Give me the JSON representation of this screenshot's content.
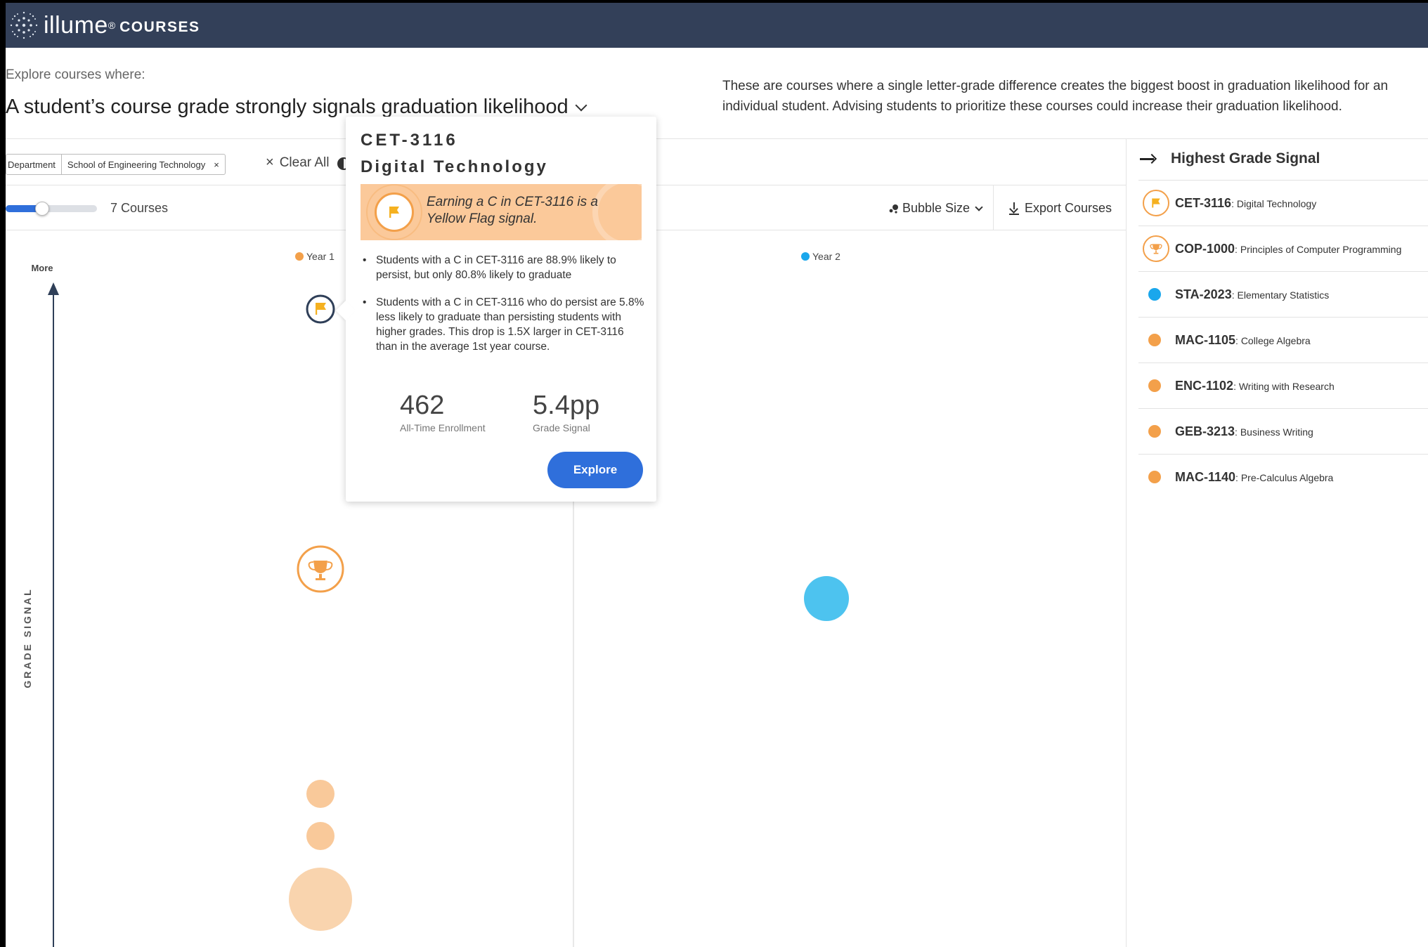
{
  "app": {
    "brand": "illume",
    "brand_mark": "®",
    "product": "COURSES"
  },
  "explore": {
    "label": "Explore courses where:",
    "title": "A student’s course grade strongly signals graduation likelihood",
    "description": "These are courses where a single letter-grade difference creates the biggest boost in graduation likelihood for an individual student. Advising students to prioritize these courses could increase their graduation likelihood."
  },
  "filters": {
    "chip_key": "Department",
    "chip_value": "School of Engineering Technology",
    "chip_remove": "×",
    "clear_all": "Clear All",
    "clear_icon": "×"
  },
  "toolbar": {
    "course_count": "7 Courses",
    "slider_level": 0.4,
    "bubble_size_label": "Bubble Size",
    "export_label": "Export Courses"
  },
  "chart": {
    "axis_top_label": "More",
    "y_axis_label": "GRADE SIGNAL",
    "year1_label": "Year 1",
    "year2_label": "Year 2",
    "colors": {
      "year1": "#f3a04a",
      "year1_light": "#f9c99a",
      "year2": "#4dc3ef",
      "axis": "#2f3f58"
    }
  },
  "chart_data": {
    "type": "scatter",
    "title": "",
    "xlabel": "",
    "ylabel": "GRADE SIGNAL",
    "categories": [
      "Year 1",
      "Year 2"
    ],
    "series": [
      {
        "name": "Year 1",
        "points": [
          {
            "course": "CET-3116",
            "icon": "flag-icon"
          },
          {
            "course": "COP-1000",
            "icon": "trophy-icon"
          },
          {
            "course": "",
            "icon": ""
          },
          {
            "course": "",
            "icon": ""
          },
          {
            "course": "",
            "icon": ""
          }
        ]
      },
      {
        "name": "Year 2",
        "points": [
          {
            "course": "STA-2023",
            "icon": ""
          }
        ]
      }
    ]
  },
  "right_panel": {
    "header": "Highest Grade Signal",
    "items": [
      {
        "code": "CET-3116",
        "name": ": Digital Technology",
        "marker": "flag-ring",
        "color": "#f3a04a"
      },
      {
        "code": "COP-1000",
        "name": ": Principles of Computer Programming",
        "marker": "trophy-ring",
        "color": "#f3a04a"
      },
      {
        "code": "STA-2023",
        "name": ": Elementary Statistics",
        "marker": "dot",
        "color": "#1aa7ec"
      },
      {
        "code": "MAC-1105",
        "name": ": College Algebra",
        "marker": "dot",
        "color": "#f3a04a"
      },
      {
        "code": "ENC-1102",
        "name": ": Writing with Research",
        "marker": "dot",
        "color": "#f3a04a"
      },
      {
        "code": "GEB-3213",
        "name": ": Business Writing",
        "marker": "dot",
        "color": "#f3a04a"
      },
      {
        "code": "MAC-1140",
        "name": ": Pre-Calculus Algebra",
        "marker": "dot",
        "color": "#f3a04a"
      }
    ]
  },
  "tooltip": {
    "code": "CET-3116",
    "title": "Digital Technology",
    "banner": "Earning a C in CET-3116 is a Yellow Flag signal.",
    "bullets": [
      "Students with a C in CET-3116 are 88.9% likely to persist, but only 80.8% likely to graduate",
      "Students with a C in CET-3116 who do persist are 5.8% less likely to graduate than persisting students with higher grades. This drop is 1.5X larger in CET-3116 than in the average 1st year course."
    ],
    "stat1_value": "462",
    "stat1_label": "All-Time Enrollment",
    "stat2_value": "5.4pp",
    "stat2_label": "Grade Signal",
    "explore_label": "Explore"
  }
}
